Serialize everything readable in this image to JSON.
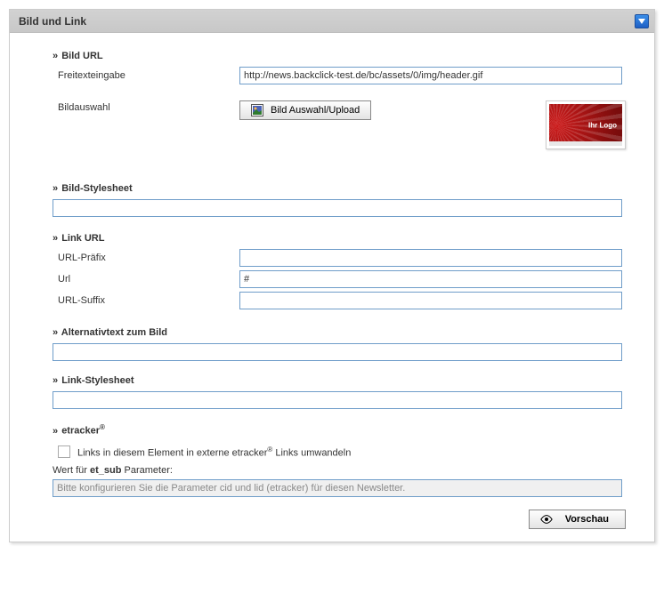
{
  "panel": {
    "title": "Bild und Link"
  },
  "sections": {
    "bild_url": {
      "heading": "Bild URL",
      "freitext_label": "Freitexteingabe",
      "freitext_value": "http://news.backclick-test.de/bc/assets/0/img/header.gif",
      "bildauswahl_label": "Bildauswahl",
      "bildauswahl_button": "Bild Auswahl/Upload",
      "thumbnail_text": "Ihr Logo"
    },
    "bild_stylesheet": {
      "heading": "Bild-Stylesheet",
      "value": ""
    },
    "link_url": {
      "heading": "Link URL",
      "prefix_label": "URL-Präfix",
      "prefix_value": "",
      "url_label": "Url",
      "url_value": "#",
      "suffix_label": "URL-Suffix",
      "suffix_value": ""
    },
    "alt_text": {
      "heading": "Alternativtext zum Bild",
      "value": ""
    },
    "link_stylesheet": {
      "heading": "Link-Stylesheet",
      "value": ""
    },
    "etracker": {
      "heading_prefix": "etracker",
      "checkbox_label_prefix": "Links in diesem Element in externe etracker",
      "checkbox_label_suffix": " Links umwandeln",
      "param_label_prefix": "Wert für ",
      "param_label_bold": "et_sub",
      "param_label_suffix": " Parameter:",
      "param_value": "Bitte konfigurieren Sie die Parameter cid und lid (etracker) für diesen Newsletter."
    }
  },
  "footer": {
    "preview_button": "Vorschau"
  }
}
